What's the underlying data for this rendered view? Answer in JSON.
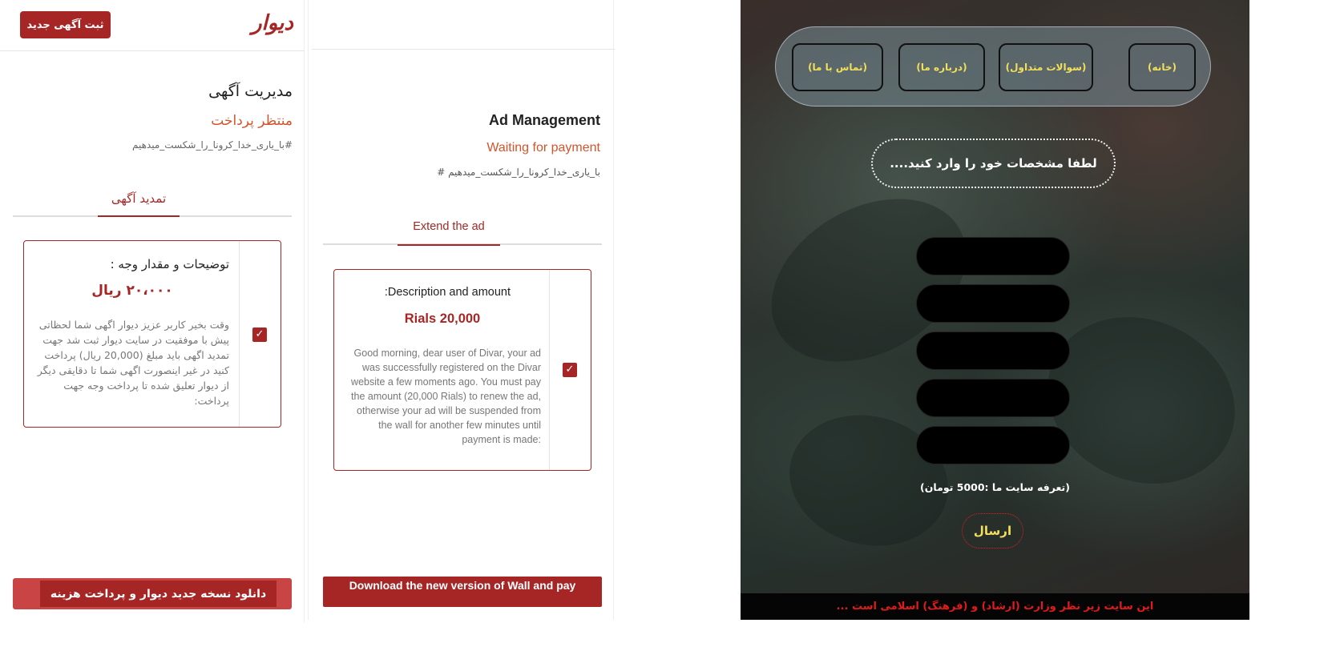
{
  "fa_panel": {
    "new_ad_button": "ثبت آگهی جدید",
    "logo": "دیوار",
    "title": "مدیریت آگهی",
    "status": "منتظر پرداخت",
    "hashtag": "#با_یاری_خدا_کرونا_را_شکست_میدهیم",
    "tab": "تمدید آگهی",
    "card_title": "توضیحات و مقدار وجه :",
    "amount": "۲۰،۰۰۰ ریال",
    "body": "وقت بخیر کاربر عزیز دیوار اگهی شما لحظاتی پیش با موفقیت در سایت دیوار ثبت شد جهت تمدید اگهی باید مبلغ (20,000 ریال) پرداخت کنید در غیر اینصورت اگهی شما تا دقایقی دیگر از دیوار تعلیق شده تا پرداخت وجه جهت پرداخت:",
    "download_button": "دانلود نسخه جدید دیوار و پرداخت هزینه"
  },
  "en_panel": {
    "title": "Ad Management",
    "status": "Waiting for payment",
    "hashtag": "# با_یاری_خدا_کرونا_را_شکست_میدهیم",
    "tab": "Extend the ad",
    "card_title": ":Description and amount",
    "amount": "Rials 20,000",
    "body": "Good morning, dear user of Divar, your ad was successfully registered on the Divar website a few moments ago. You must pay the amount (20,000 Rials) to renew the ad, otherwise your ad will be suspended from the wall for another few minutes until payment is made:",
    "download_button": "Download the new version of Wall and pay"
  },
  "phish_panel": {
    "nav": {
      "home": "(خانه)",
      "faq": "(سوالات متداول)",
      "about": "(درباره ما)",
      "contact": "(تماس با ما)"
    },
    "prompt": "لطفا مشخصات خود را وارد کنید....",
    "price_note": "(تعرفه سایت ما :5000 تومان)",
    "submit": "ارسال",
    "footer": "این سایت زیر نظر وزارت (ارشاد) و (فرهنگ) اسلامی است ...",
    "colors": {
      "nav_text": "#f2e05a",
      "footer_text": "#e41a1a",
      "submit_border": "#e02020"
    }
  },
  "colors": {
    "brand_red": "#a62626",
    "status_orange": "#d3542a"
  }
}
